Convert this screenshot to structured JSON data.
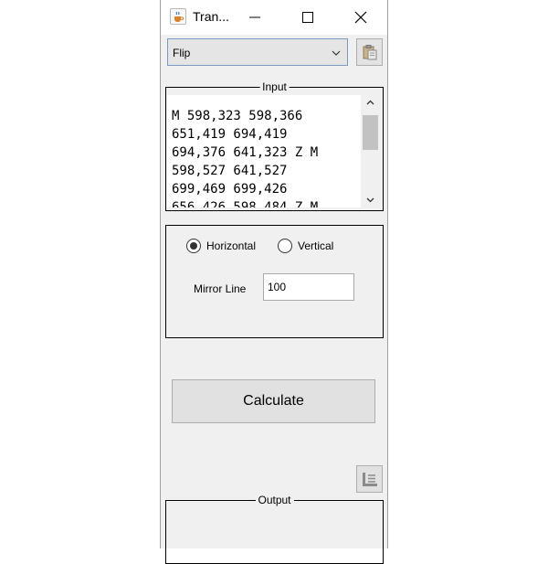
{
  "window": {
    "title": "Tran...",
    "icon": "java-cup-icon"
  },
  "transform_select": {
    "value": "Flip",
    "icon": "chevron-down-icon"
  },
  "toolbar": {
    "paste_icon": "clipboard-paste-icon",
    "copy_icon": "copy-output-icon"
  },
  "input": {
    "title": "Input",
    "lines": [
      "M 598,323 598,366",
      "651,419 694,419",
      "694,376 641,323 Z M",
      "598,527 641,527",
      "699,469 699,426",
      "656,426 598,484 Z M"
    ]
  },
  "options": {
    "horizontal_label": "Horizontal",
    "vertical_label": "Vertical",
    "selected": "Horizontal",
    "mirror_line_label": "Mirror Line",
    "mirror_line_value": "100"
  },
  "calculate_label": "Calculate",
  "output": {
    "title": "Output"
  },
  "colors": {
    "window_bg": "#f0f0f0",
    "select_border": "#7a9ac2",
    "button_bg": "#e1e1e1"
  }
}
